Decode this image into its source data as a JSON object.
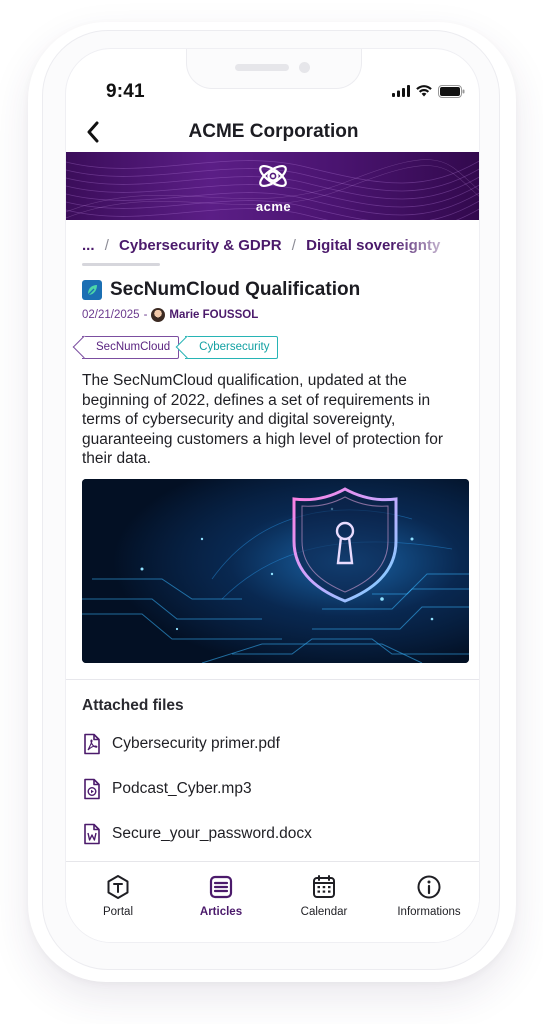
{
  "status_bar": {
    "time": "9:41"
  },
  "header": {
    "title": "ACME Corporation"
  },
  "banner": {
    "logo_text": "acme"
  },
  "breadcrumb": {
    "ellipsis": "...",
    "separator": "/",
    "items": [
      "Cybersecurity & GDPR",
      "Digital sovereignty"
    ]
  },
  "article": {
    "title": "SecNumCloud Qualification",
    "date": "02/21/2025",
    "date_separator": "-",
    "author": "Marie FOUSSOL",
    "tags": [
      "SecNumCloud",
      "Cybersecurity"
    ],
    "body": "The SecNumCloud qualification, updated at the beginning of 2022, defines a set of requirements in terms of cybersecurity and digital sovereignty, guaranteeing customers a high level of protection for their data."
  },
  "attachments": {
    "title": "Attached files",
    "files": [
      {
        "name": "Cybersecurity primer.pdf",
        "icon": "pdf-file-icon"
      },
      {
        "name": "Podcast_Cyber.mp3",
        "icon": "audio-file-icon"
      },
      {
        "name": "Secure_your_password.docx",
        "icon": "word-file-icon"
      }
    ]
  },
  "tabbar": {
    "active": "Articles",
    "tabs": [
      {
        "label": "Portal",
        "icon": "portal-icon"
      },
      {
        "label": "Articles",
        "icon": "articles-icon"
      },
      {
        "label": "Calendar",
        "icon": "calendar-icon"
      },
      {
        "label": "Informations",
        "icon": "info-icon"
      }
    ]
  },
  "colors": {
    "brand_purple": "#4b1a6b",
    "tag_teal": "#13a1a3",
    "banner_purple": "#5b1e86"
  }
}
